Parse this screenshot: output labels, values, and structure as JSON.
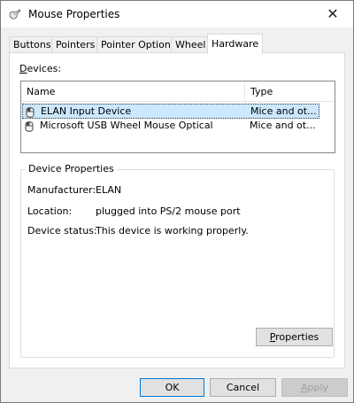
{
  "window": {
    "title": "Mouse Properties",
    "close_glyph": "✕"
  },
  "tabs": [
    {
      "label": "Buttons"
    },
    {
      "label": "Pointers"
    },
    {
      "label": "Pointer Options"
    },
    {
      "label": "Wheel"
    },
    {
      "label": "Hardware"
    }
  ],
  "devices": {
    "label_mnemonic": "D",
    "label_rest": "evices:",
    "columns": {
      "name": "Name",
      "type": "Type"
    },
    "rows": [
      {
        "name": "ELAN Input Device",
        "type": "Mice and ot...",
        "selected": true,
        "icon": "mouse-icon"
      },
      {
        "name": "Microsoft USB Wheel Mouse Optical",
        "type": "Mice and ot...",
        "selected": false,
        "icon": "mouse-icon"
      }
    ]
  },
  "device_properties": {
    "title": "Device Properties",
    "manufacturer_label": "Manufacturer:",
    "manufacturer_value": "ELAN",
    "location_label": "Location:",
    "location_value": "plugged into PS/2 mouse port",
    "status_label": "Device status:",
    "status_value": "This device is working properly.",
    "properties_button_mnemonic": "P",
    "properties_button_rest": "roperties"
  },
  "footer": {
    "ok": "OK",
    "cancel": "Cancel",
    "apply_mnemonic": "A",
    "apply_rest": "pply"
  },
  "colors": {
    "selection": "#cce8ff",
    "accent": "#0078d7"
  }
}
